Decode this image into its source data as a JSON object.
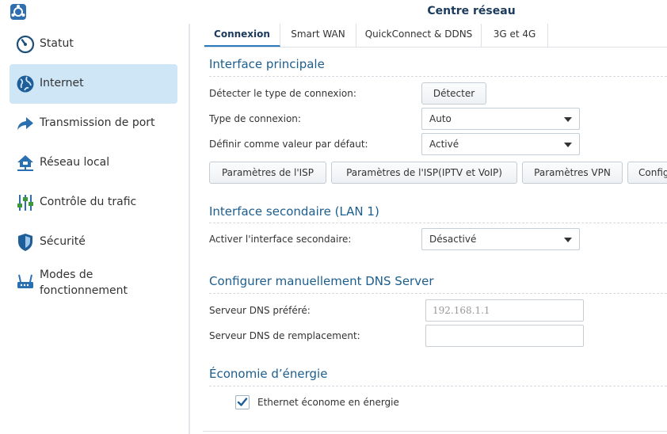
{
  "window": {
    "title": "Centre réseau",
    "app_icon": "network-center-icon"
  },
  "sidebar": {
    "items": [
      {
        "label": "Statut",
        "icon": "gauge-icon",
        "active": false
      },
      {
        "label": "Internet",
        "icon": "globe-icon",
        "active": true
      },
      {
        "label": "Transmission de port",
        "icon": "forward-arrow-icon",
        "active": false
      },
      {
        "label": "Réseau local",
        "icon": "home-network-icon",
        "active": false
      },
      {
        "label": "Contrôle du trafic",
        "icon": "sliders-icon",
        "active": false
      },
      {
        "label": "Sécurité",
        "icon": "shield-icon",
        "active": false
      },
      {
        "label": "Modes de fonctionnement",
        "label_line1": "Modes de",
        "label_line2": "fonctionnement",
        "icon": "router-icon",
        "active": false
      }
    ]
  },
  "tabs": [
    {
      "label": "Connexion",
      "active": true
    },
    {
      "label": "Smart WAN",
      "active": false
    },
    {
      "label": "QuickConnect & DDNS",
      "active": false
    },
    {
      "label": "3G et 4G",
      "active": false
    }
  ],
  "primary": {
    "title": "Interface principale",
    "detect_label": "Détecter le type de connexion:",
    "detect_button": "Détecter",
    "connection_type_label": "Type de connexion:",
    "connection_type_value": "Auto",
    "default_label": "Définir comme valeur par défaut:",
    "default_value": "Activé",
    "buttons": {
      "isp": "Paramètres de l'ISP",
      "isp_iptv": "Paramètres de l'ISP(IPTV et VoIP)",
      "vpn": "Paramètres VPN",
      "config": "Configuration"
    }
  },
  "secondary": {
    "title": "Interface secondaire (LAN 1)",
    "enable_label": "Activer l'interface secondaire:",
    "enable_value": "Désactivé"
  },
  "dns": {
    "title": "Configurer manuellement DNS Server",
    "preferred_label": "Serveur DNS préféré:",
    "preferred_placeholder": "192.168.1.1",
    "alternate_label": "Serveur DNS de remplacement:",
    "alternate_value": ""
  },
  "energy": {
    "title": "Économie d’énergie",
    "eee_label": "Ethernet économe en énergie",
    "eee_checked": true
  },
  "colors": {
    "accent": "#2a7ac0",
    "section_title": "#1b5e8f",
    "active_nav_bg": "#cfe6f7"
  }
}
